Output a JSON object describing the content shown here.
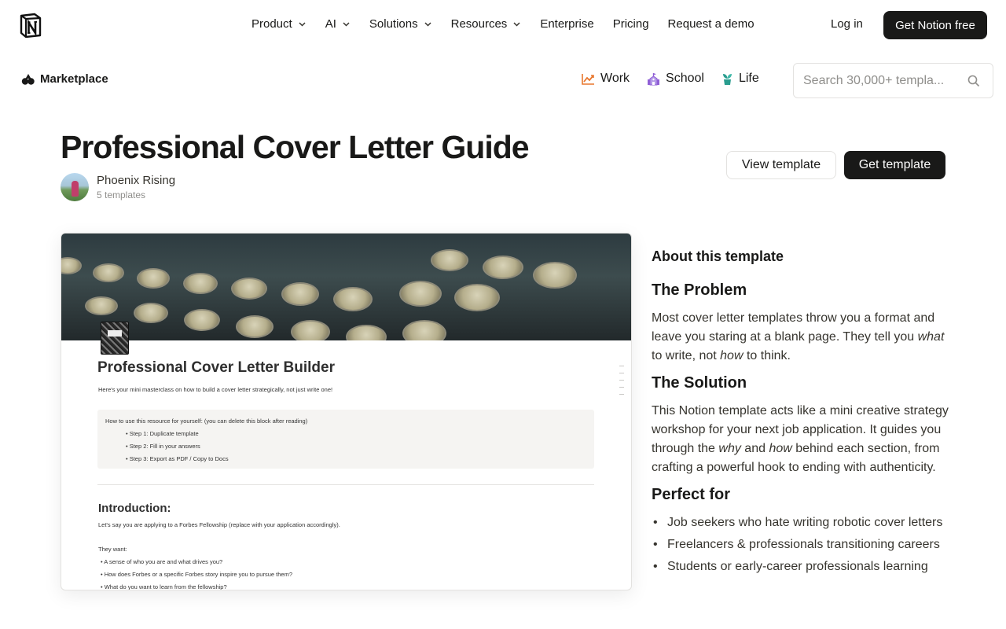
{
  "nav": {
    "items": [
      {
        "label": "Product",
        "has_chevron": true
      },
      {
        "label": "AI",
        "has_chevron": true
      },
      {
        "label": "Solutions",
        "has_chevron": true
      },
      {
        "label": "Resources",
        "has_chevron": true
      },
      {
        "label": "Enterprise",
        "has_chevron": false
      },
      {
        "label": "Pricing",
        "has_chevron": false
      },
      {
        "label": "Request a demo",
        "has_chevron": false
      }
    ],
    "login_label": "Log in",
    "cta_label": "Get Notion free"
  },
  "marketplace": {
    "label": "Marketplace",
    "categories": [
      {
        "label": "Work",
        "icon": "chart-icon",
        "color": "#e8772e"
      },
      {
        "label": "School",
        "icon": "school-icon",
        "color": "#8f5ed6"
      },
      {
        "label": "Life",
        "icon": "plant-icon",
        "color": "#2a9d8f"
      }
    ],
    "search_placeholder": "Search 30,000+ templa..."
  },
  "template": {
    "title": "Professional Cover Letter Guide",
    "author_name": "Phoenix Rising",
    "author_count": "5 templates",
    "view_label": "View template",
    "get_label": "Get template"
  },
  "preview": {
    "title": "Professional Cover Letter Builder",
    "subtitle": "Here's your mini masterclass on how to build a cover letter strategically, not just write one!",
    "callout_head": "How to use this resource for yourself: (you can delete this block after reading)",
    "steps": [
      "Step 1: Duplicate template",
      "Step 2: Fill in your answers",
      "Step 3: Export as PDF / Copy to Docs"
    ],
    "intro_heading": "Introduction:",
    "intro_text": "Let's say you are applying to a Forbes Fellowship (replace with your application accordingly).",
    "want_label": "They want:",
    "wants": [
      "A sense of who you are and what drives you?",
      "How does Forbes or a specific Forbes story inspire you to pursue them?",
      "What do you want to learn from the fellowship?"
    ]
  },
  "about": {
    "heading": "About this template",
    "problem_heading": "The Problem",
    "problem_text_1": "Most cover letter templates throw you a format and leave you staring at a blank page. They tell you ",
    "problem_em_1": "what",
    "problem_text_2": " to write, not ",
    "problem_em_2": "how",
    "problem_text_3": " to think.",
    "solution_heading": "The Solution",
    "solution_text_1": "This Notion template acts like a mini creative strategy workshop for your next job application. It guides you through the ",
    "solution_em_1": "why",
    "solution_text_2": " and ",
    "solution_em_2": "how",
    "solution_text_3": " behind each section, from crafting a powerful hook to ending with authenticity.",
    "perfect_heading": "Perfect for",
    "perfect_items": [
      "Job seekers who hate writing robotic cover letters",
      "Freelancers & professionals transitioning careers",
      "Students or early-career professionals learning"
    ]
  }
}
